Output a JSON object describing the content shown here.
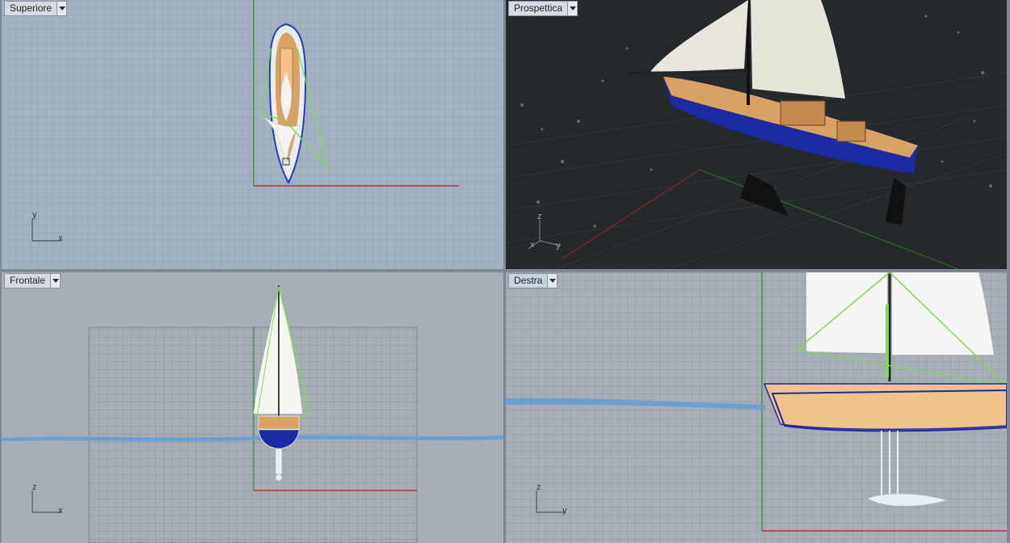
{
  "viewports": {
    "top": {
      "title": "Superiore",
      "axis_v": "y",
      "axis_h": "x"
    },
    "perspective": {
      "title": "Prospettica",
      "axis_v": "z",
      "axis_h": "y",
      "axis_d": "x"
    },
    "front": {
      "title": "Frontale",
      "axis_v": "z",
      "axis_h": "x"
    },
    "right": {
      "title": "Destra",
      "axis_v": "z",
      "axis_h": "y"
    }
  },
  "colors": {
    "viewport_bg": "#a1aab4",
    "perspective_bg": "#26292c",
    "grid_line": "#8c949d",
    "water": "#6b9fd4",
    "hull_wood": "#d8a265",
    "hull_blue": "#1a2aa0",
    "sail": "#f3f3ef",
    "rigging": "#7ed957",
    "x_axis": "#b22222",
    "y_axis": "#2e8b2e"
  },
  "icons": [
    "dropdown-arrow-icon"
  ]
}
